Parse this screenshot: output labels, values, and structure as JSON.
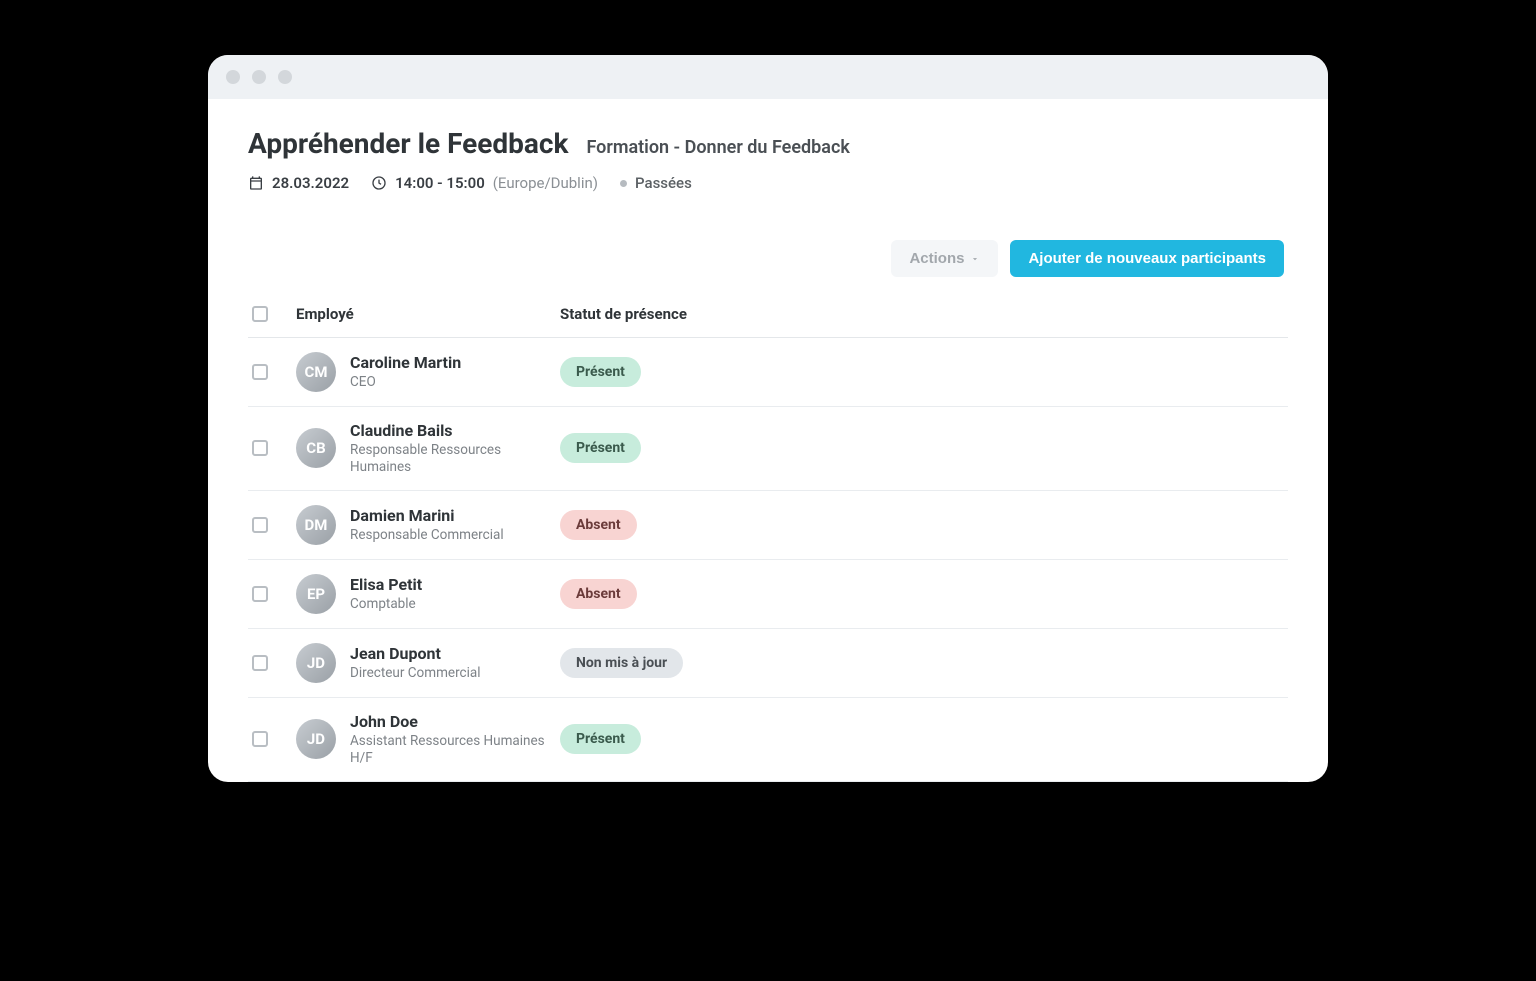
{
  "header": {
    "title": "Appréhender le Feedback",
    "subtitle": "Formation - Donner du Feedback",
    "date": "28.03.2022",
    "time": "14:00 - 15:00",
    "timezone": "(Europe/Dublin)",
    "status": "Passées"
  },
  "actions": {
    "actions_label": "Actions",
    "add_label": "Ajouter de nouveaux participants"
  },
  "table": {
    "columns": {
      "employee": "Employé",
      "presence": "Statut de présence"
    },
    "rows": [
      {
        "name": "Caroline Martin",
        "role": "CEO",
        "initials": "CM",
        "status_label": "Présent",
        "status_class": "present"
      },
      {
        "name": "Claudine Bails",
        "role": "Responsable Ressources Humaines",
        "initials": "CB",
        "status_label": "Présent",
        "status_class": "present"
      },
      {
        "name": "Damien Marini",
        "role": "Responsable Commercial",
        "initials": "DM",
        "status_label": "Absent",
        "status_class": "absent"
      },
      {
        "name": "Elisa Petit",
        "role": "Comptable",
        "initials": "EP",
        "status_label": "Absent",
        "status_class": "absent"
      },
      {
        "name": "Jean Dupont",
        "role": "Directeur Commercial",
        "initials": "JD",
        "status_label": "Non mis à jour",
        "status_class": "notupdated"
      },
      {
        "name": "John Doe",
        "role": "Assistant Ressources Humaines H/F",
        "initials": "JD",
        "status_label": "Présent",
        "status_class": "present"
      }
    ]
  }
}
